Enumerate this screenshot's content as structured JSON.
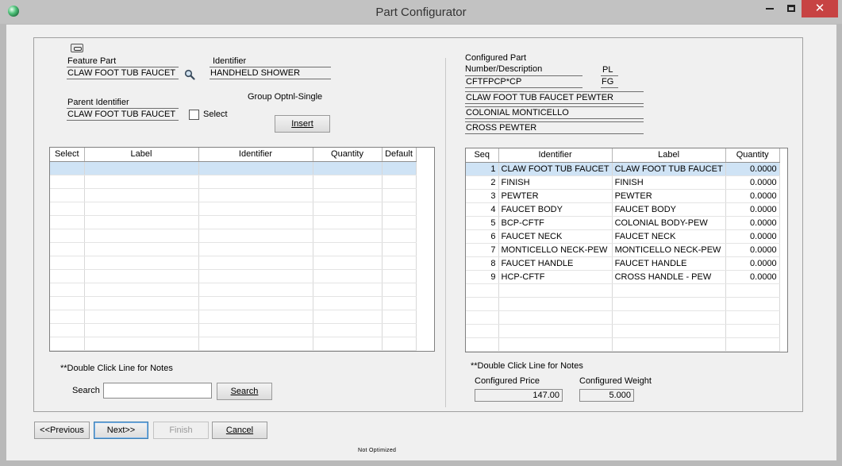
{
  "window": {
    "title": "Part Configurator",
    "close_glyph": "✕"
  },
  "feature": {
    "feature_part_label": "Feature Part",
    "feature_part_value": "CLAW FOOT TUB FAUCET",
    "identifier_label": "Identifier",
    "identifier_value": "HANDHELD SHOWER",
    "parent_identifier_label": "Parent Identifier",
    "parent_identifier_value": "CLAW FOOT TUB FAUCET",
    "select_label": "Select",
    "group_label": "Group Optnl-Single",
    "insert_label": "Insert"
  },
  "left_grid": {
    "headers": [
      "Select",
      "Label",
      "Identifier",
      "Quantity",
      "Default"
    ]
  },
  "left_notes": "**Double Click Line for Notes",
  "search": {
    "label": "Search",
    "value": "",
    "button_label": "Search"
  },
  "configured": {
    "title_line1": "Configured Part",
    "title_line2": "Number/Description",
    "part_number": "CFTFPCP*CP",
    "pl_label": "PL",
    "pl_value": "FG",
    "desc1": "CLAW FOOT TUB FAUCET PEWTER",
    "desc2": "COLONIAL MONTICELLO",
    "desc3": "CROSS PEWTER"
  },
  "right_grid": {
    "headers": [
      "Seq",
      "Identifier",
      "Label",
      "Quantity"
    ],
    "rows": [
      [
        "1",
        "CLAW FOOT TUB FAUCET",
        "CLAW FOOT TUB FAUCET",
        "0.0000"
      ],
      [
        "2",
        "FINISH",
        "FINISH",
        "0.0000"
      ],
      [
        "3",
        "PEWTER",
        "PEWTER",
        "0.0000"
      ],
      [
        "4",
        "FAUCET BODY",
        "FAUCET BODY",
        "0.0000"
      ],
      [
        "5",
        "BCP-CFTF",
        "COLONIAL BODY-PEW",
        "0.0000"
      ],
      [
        "6",
        "FAUCET NECK",
        "FAUCET NECK",
        "0.0000"
      ],
      [
        "7",
        "MONTICELLO NECK-PEW",
        "MONTICELLO NECK-PEW",
        "0.0000"
      ],
      [
        "8",
        "FAUCET HANDLE",
        "FAUCET HANDLE",
        "0.0000"
      ],
      [
        "9",
        "HCP-CFTF",
        "CROSS HANDLE - PEW",
        "0.0000"
      ]
    ]
  },
  "right_notes": "**Double Click Line for Notes",
  "price": {
    "price_label": "Configured Price",
    "price_value": "147.00",
    "weight_label": "Configured Weight",
    "weight_value": "5.000"
  },
  "nav": {
    "previous": "<<Previous",
    "next": "Next>>",
    "finish": "Finish",
    "cancel": "Cancel"
  },
  "status": "Not Optimized",
  "icons": {
    "app": "app-globe-icon",
    "search": "magnifier-icon",
    "toggle": "expand-toggle-icon"
  }
}
